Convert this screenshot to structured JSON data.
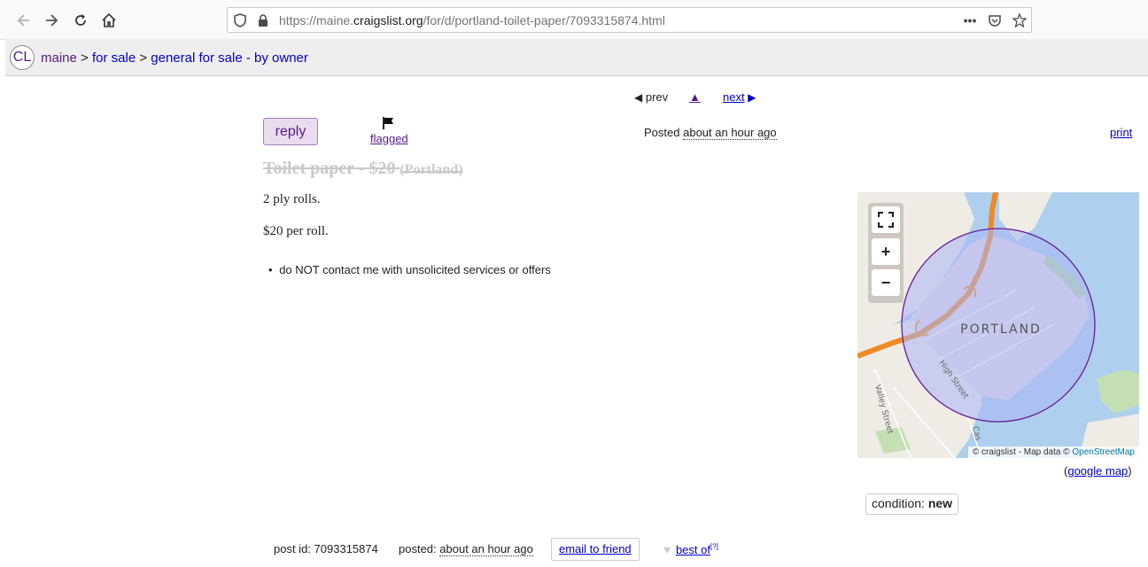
{
  "browser": {
    "url_prefix": "https://maine.",
    "url_domain": "craigslist.org",
    "url_path": "/for/d/portland-toilet-paper/7093315874.html"
  },
  "header": {
    "logo": "CL",
    "crumbs": [
      "maine",
      "for sale",
      "general for sale - by owner"
    ],
    "separator": ">"
  },
  "nav": {
    "prev": "prev",
    "up": "▲",
    "next": "next"
  },
  "actions": {
    "reply": "reply",
    "flagged": "flagged",
    "print": "print"
  },
  "posting": {
    "posted_label": "Posted",
    "posted_time": "about an hour ago",
    "title": "Toilet paper - $20",
    "neighborhood": "(Portland)",
    "body": [
      "2 ply rolls.",
      "$20 per roll."
    ],
    "notice": "do NOT contact me with unsolicited services or offers"
  },
  "map": {
    "label": "PORTLAND",
    "street_1": "High Street",
    "street_2": "Valley Street",
    "street_3": "Cas",
    "attribution_prefix": "© craigslist - Map data © ",
    "attribution_link": "OpenStreetMap",
    "google_map": "google map",
    "circle_fill": "#aab4f4",
    "circle_stroke": "#6a1b9a",
    "highway_color": "#f08a24"
  },
  "attrs": {
    "condition_label": "condition:",
    "condition_value": "new"
  },
  "footer": {
    "post_id_label": "post id:",
    "post_id": "7093315874",
    "posted_label": "posted:",
    "posted_time": "about an hour ago",
    "email_friend": "email to friend",
    "best_of": "best of",
    "best_of_sup": "[?]"
  }
}
